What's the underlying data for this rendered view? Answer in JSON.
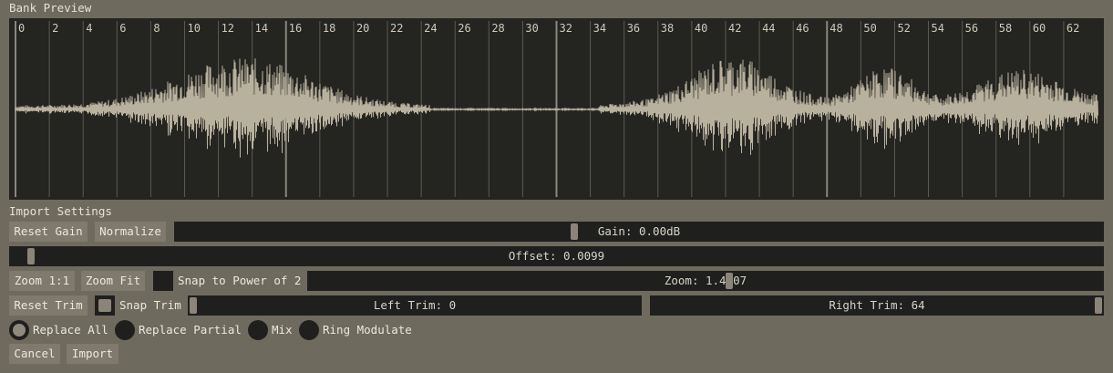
{
  "preview": {
    "title": "Bank Preview",
    "ruler_labels": [
      "0",
      "2",
      "4",
      "6",
      "8",
      "10",
      "12",
      "14",
      "16",
      "18",
      "20",
      "22",
      "24",
      "26",
      "28",
      "30",
      "32",
      "34",
      "36",
      "38",
      "40",
      "42",
      "44",
      "46",
      "48",
      "50",
      "52",
      "54",
      "56",
      "58",
      "60",
      "62"
    ],
    "colors": {
      "background": "#242420",
      "waveform": "#b8b19e",
      "gridline": "#5c5a52"
    }
  },
  "import_settings": {
    "title": "Import Settings",
    "reset_gain_label": "Reset Gain",
    "normalize_label": "Normalize",
    "gain_text": "Gain: 0.00dB",
    "gain_level": 0.43,
    "offset_text": "Offset: 0.0099",
    "offset_level": 0.015,
    "zoom_1to1_label": "Zoom 1:1",
    "zoom_fit_label": "Zoom Fit",
    "snap_power_label": "Snap to Power of 2",
    "snap_power_checked": false,
    "zoom_text": "Zoom: 1.4007",
    "zoom_level": 0.53,
    "reset_trim_label": "Reset Trim",
    "snap_trim_label": "Snap Trim",
    "snap_trim_checked": true,
    "left_trim_text": "Left Trim: 0",
    "left_trim_level": 0.0,
    "right_trim_text": "Right Trim: 64",
    "right_trim_level": 1.0
  },
  "mode": {
    "options": [
      "Replace All",
      "Replace Partial",
      "Mix",
      "Ring Modulate"
    ],
    "selected": "Replace All"
  },
  "actions": {
    "cancel_label": "Cancel",
    "import_label": "Import"
  },
  "accent_colors": {
    "button": "#7f7a6d",
    "track": "#1f1f1e",
    "handle": "#8a8578",
    "panel": "#6f6a5e"
  }
}
